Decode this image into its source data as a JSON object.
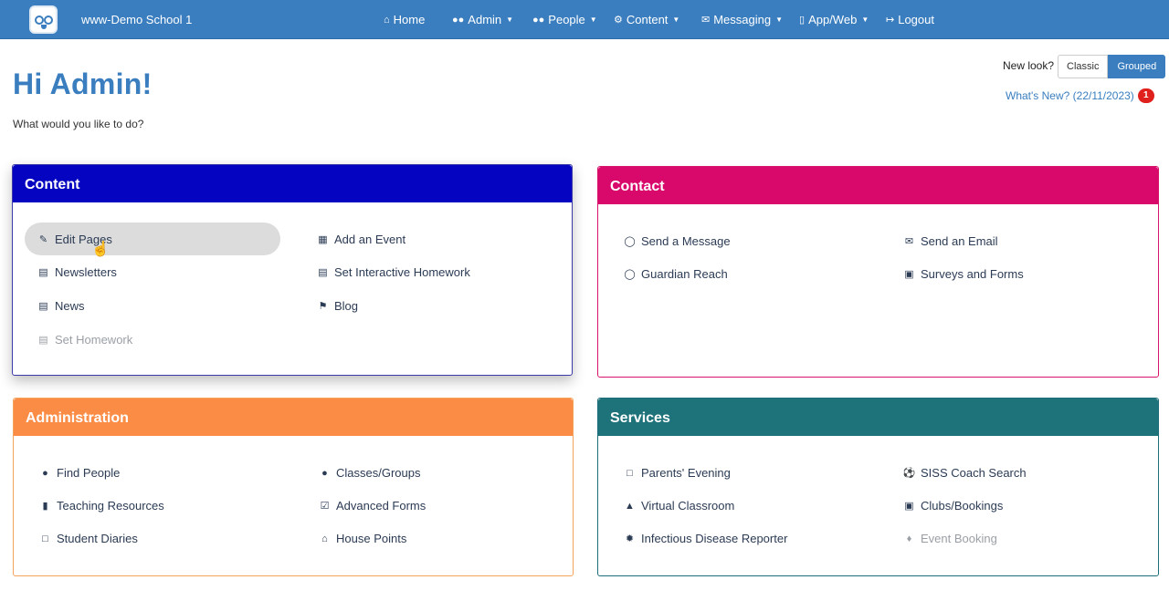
{
  "navbar": {
    "school_name": "www-Demo School 1",
    "items": [
      {
        "label": "Home",
        "icon": "home-icon"
      },
      {
        "label": "Admin",
        "icon": "users-icon"
      },
      {
        "label": "People",
        "icon": "users-icon"
      },
      {
        "label": "Content",
        "icon": "gear-icon"
      },
      {
        "label": "Messaging",
        "icon": "envelope-icon"
      },
      {
        "label": "App/Web",
        "icon": "mobile-icon"
      },
      {
        "label": "Logout",
        "icon": "logout-icon"
      }
    ]
  },
  "header": {
    "greeting": "Hi Admin!",
    "subtitle": "What would you like to do?",
    "new_look_label": "New look?",
    "toggle_classic": "Classic",
    "toggle_grouped": "Grouped",
    "whats_new": "What's New? (22/11/2023)",
    "whats_new_count": "1"
  },
  "panels": {
    "content": {
      "title": "Content",
      "items": [
        {
          "label": "Edit Pages",
          "icon": "edit-icon"
        },
        {
          "label": "Add an Event",
          "icon": "calendar-icon"
        },
        {
          "label": "Newsletters",
          "icon": "newspaper-icon"
        },
        {
          "label": "Set Interactive Homework",
          "icon": "document-icon"
        },
        {
          "label": "News",
          "icon": "newspaper-icon"
        },
        {
          "label": "Blog",
          "icon": "bookmark-icon"
        },
        {
          "label": "Set Homework",
          "icon": "document-icon"
        }
      ]
    },
    "contact": {
      "title": "Contact",
      "items": [
        {
          "label": "Send a Message",
          "icon": "speech-bubble-icon"
        },
        {
          "label": "Send an Email",
          "icon": "envelope-icon"
        },
        {
          "label": "Guardian Reach",
          "icon": "chat-icon"
        },
        {
          "label": "Surveys and Forms",
          "icon": "clipboard-icon"
        }
      ]
    },
    "administration": {
      "title": "Administration",
      "items": [
        {
          "label": "Find People",
          "icon": "user-icon"
        },
        {
          "label": "Classes/Groups",
          "icon": "users-icon"
        },
        {
          "label": "Teaching Resources",
          "icon": "book-icon"
        },
        {
          "label": "Advanced Forms",
          "icon": "check-square-icon"
        },
        {
          "label": "Student Diaries",
          "icon": "calendar-icon"
        },
        {
          "label": "House Points",
          "icon": "home-icon"
        }
      ]
    },
    "services": {
      "title": "Services",
      "items": [
        {
          "label": "Parents' Evening",
          "icon": "calendar-icon"
        },
        {
          "label": "SISS Coach Search",
          "icon": "football-icon"
        },
        {
          "label": "Virtual Classroom",
          "icon": "graduation-cap-icon"
        },
        {
          "label": "Clubs/Bookings",
          "icon": "calendar-check-icon"
        },
        {
          "label": "Infectious Disease Reporter",
          "icon": "bug-icon"
        },
        {
          "label": "Event Booking",
          "icon": "ticket-icon"
        }
      ]
    }
  },
  "colors": {
    "navbar": "#3a7ebf",
    "content_head": "#0504c1",
    "contact_head": "#d8096b",
    "administration_head": "#fb8c45",
    "services_head": "#1e727a",
    "badge": "#e0201c"
  }
}
